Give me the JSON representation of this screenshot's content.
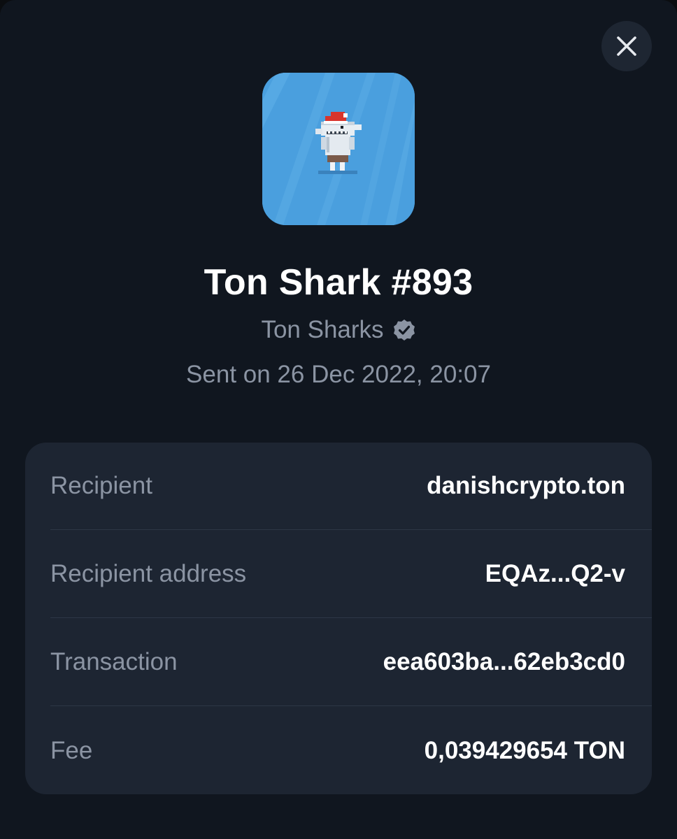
{
  "nft": {
    "title": "Ton Shark #893",
    "collection": "Ton Sharks",
    "sent_date": "Sent on 26 Dec 2022, 20:07"
  },
  "details": [
    {
      "label": "Recipient",
      "value": "danishcrypto.ton"
    },
    {
      "label": "Recipient address",
      "value": "EQAz...Q2-v"
    },
    {
      "label": "Transaction",
      "value": "eea603ba...62eb3cd0"
    },
    {
      "label": "Fee",
      "value": "0,039429654 TON"
    }
  ],
  "icons": {
    "close": "close-icon",
    "verified": "verified-badge-icon"
  },
  "colors": {
    "background": "#10161f",
    "card": "#1d2532",
    "muted_text": "#8b94a3",
    "nft_background": "#4a9fde"
  }
}
